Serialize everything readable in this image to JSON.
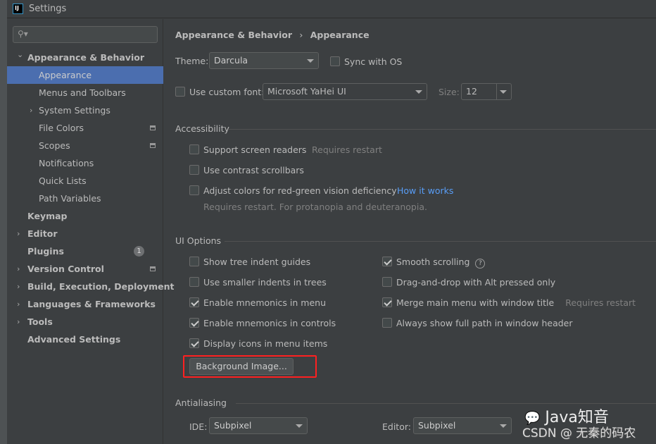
{
  "window": {
    "title": "Settings"
  },
  "sidebar": {
    "search_placeholder": "",
    "items": [
      {
        "label": "Appearance & Behavior",
        "level": 0,
        "expanded": true,
        "bold": true
      },
      {
        "label": "Appearance",
        "level": 1,
        "selected": true
      },
      {
        "label": "Menus and Toolbars",
        "level": 1
      },
      {
        "label": "System Settings",
        "level": 1,
        "arrow": true
      },
      {
        "label": "File Colors",
        "level": 1,
        "mark": true
      },
      {
        "label": "Scopes",
        "level": 1,
        "mark": true
      },
      {
        "label": "Notifications",
        "level": 1
      },
      {
        "label": "Quick Lists",
        "level": 1
      },
      {
        "label": "Path Variables",
        "level": 1
      },
      {
        "label": "Keymap",
        "level": 0,
        "bold": true
      },
      {
        "label": "Editor",
        "level": 0,
        "arrow": true,
        "bold": true
      },
      {
        "label": "Plugins",
        "level": 0,
        "bold": true,
        "badge": "1"
      },
      {
        "label": "Version Control",
        "level": 0,
        "arrow": true,
        "bold": true,
        "mark": true
      },
      {
        "label": "Build, Execution, Deployment",
        "level": 0,
        "arrow": true,
        "bold": true
      },
      {
        "label": "Languages & Frameworks",
        "level": 0,
        "arrow": true,
        "bold": true
      },
      {
        "label": "Tools",
        "level": 0,
        "arrow": true,
        "bold": true
      },
      {
        "label": "Advanced Settings",
        "level": 0,
        "bold": true
      }
    ]
  },
  "breadcrumb": {
    "parent": "Appearance & Behavior",
    "sep": "›",
    "current": "Appearance"
  },
  "theme": {
    "label": "Theme:",
    "value": "Darcula",
    "sync_label": "Sync with OS",
    "sync_checked": false
  },
  "font": {
    "label": "Use custom font:",
    "checked": false,
    "value": "Microsoft YaHei UI",
    "size_label": "Size:",
    "size": "12"
  },
  "accessibility": {
    "title": "Accessibility",
    "screen_readers": "Support screen readers",
    "screen_readers_hint": "Requires restart",
    "contrast": "Use contrast scrollbars",
    "color_def": "Adjust colors for red-green vision deficiency",
    "color_def_link": "How it works",
    "color_def_hint": "Requires restart. For protanopia and deuteranopia."
  },
  "ui_options": {
    "title": "UI Options",
    "left": [
      {
        "label": "Show tree indent guides",
        "checked": false
      },
      {
        "label": "Use smaller indents in trees",
        "checked": false
      },
      {
        "label": "Enable mnemonics in menu",
        "checked": true
      },
      {
        "label": "Enable mnemonics in controls",
        "checked": true
      },
      {
        "label": "Display icons in menu items",
        "checked": true
      }
    ],
    "right": [
      {
        "label": "Smooth scrolling",
        "checked": true
      },
      {
        "label": "Drag-and-drop with Alt pressed only",
        "checked": false
      },
      {
        "label": "Merge main menu with window title",
        "checked": true,
        "hint": "Requires restart"
      },
      {
        "label": "Always show full path in window header",
        "checked": false
      }
    ],
    "help": "?",
    "bg_button": "Background Image..."
  },
  "antialiasing": {
    "title": "Antialiasing",
    "ide_label": "IDE:",
    "ide_value": "Subpixel",
    "editor_label": "Editor:",
    "editor_value": "Subpixel"
  },
  "watermark": {
    "line1": "Java知音",
    "line2": "CSDN @ 无秦的码农"
  },
  "colors": {
    "selection": "#4b6eaf",
    "background": "#3c3f41",
    "link": "#589df6",
    "highlight_box": "#ff2020"
  }
}
